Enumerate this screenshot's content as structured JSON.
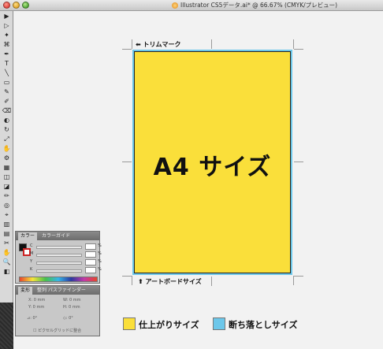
{
  "window": {
    "title": "Illustrator CS5データ.ai* @ 66.67% (CMYK/プレビュー)"
  },
  "tools": [
    "▶",
    "▷",
    "✦",
    "⌘",
    "✒",
    "T",
    "╲",
    "▭",
    "✎",
    "✐",
    "⌫",
    "◐",
    "↻",
    "⤢",
    "✋",
    "⚙",
    "▦",
    "◫",
    "◪",
    "✏",
    "◎",
    "⌖",
    "▥",
    "▤",
    "✂",
    "✋",
    "🔍",
    "◧"
  ],
  "canvas": {
    "artboard_title": "A4 サイズ",
    "trim_mark_label": "トリムマーク",
    "artboard_size_label": "アートボードサイズ",
    "arrow_left": "⬅",
    "arrow_up": "⬆"
  },
  "legend": {
    "finish_size": "仕上がりサイズ",
    "bleed_size": "断ち落としサイズ",
    "finish_color": "#fadf3a",
    "bleed_color": "#6cc7ea"
  },
  "color_panel": {
    "tab_color": "カラー",
    "tab_guide": "カラーガイド",
    "channels": [
      "C",
      "M",
      "Y",
      "K"
    ],
    "unit": "%"
  },
  "transform_panel": {
    "tab_transform": "変形",
    "tab_pathfinder": "整列 パスファインダー",
    "x_label": "X:",
    "y_label": "Y:",
    "w_label": "W:",
    "h_label": "H:",
    "x_value": "0 mm",
    "y_value": "0 mm",
    "w_value": "0 mm",
    "h_value": "0 mm",
    "angle_label": "⊿:",
    "angle_value": "0°",
    "shear_label": "◇:",
    "shear_value": "0°",
    "pixel_grid": "ピクセルグリッドに整合"
  }
}
